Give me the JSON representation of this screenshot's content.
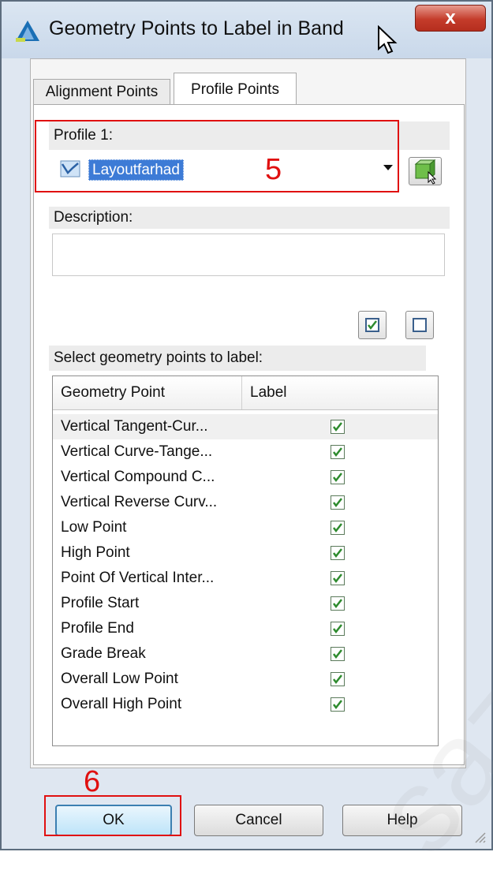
{
  "window": {
    "title": "Geometry Points to Label in Band",
    "close_label": "x"
  },
  "tabs": [
    {
      "label": "Alignment Points",
      "active": false
    },
    {
      "label": "Profile Points",
      "active": true
    }
  ],
  "profile": {
    "label": "Profile 1:",
    "selected_value": "Layoutfarhad"
  },
  "description": {
    "label": "Description:",
    "value": ""
  },
  "select_label": "Select geometry points to label:",
  "grid": {
    "columns": [
      "Geometry Point",
      "Label"
    ],
    "rows": [
      {
        "name": "Vertical Tangent-Cur...",
        "checked": true
      },
      {
        "name": "Vertical Curve-Tange...",
        "checked": true
      },
      {
        "name": "Vertical Compound C...",
        "checked": true
      },
      {
        "name": "Vertical Reverse Curv...",
        "checked": true
      },
      {
        "name": "Low Point",
        "checked": true
      },
      {
        "name": "High Point",
        "checked": true
      },
      {
        "name": "Point Of Vertical Inter...",
        "checked": true
      },
      {
        "name": "Profile Start",
        "checked": true
      },
      {
        "name": "Profile End",
        "checked": true
      },
      {
        "name": "Grade Break",
        "checked": true
      },
      {
        "name": "Overall Low Point",
        "checked": true
      },
      {
        "name": "Overall High Point",
        "checked": true
      }
    ]
  },
  "buttons": {
    "ok": "OK",
    "cancel": "Cancel",
    "help": "Help"
  },
  "annotations": {
    "profile_marker": "5",
    "ok_marker": "6"
  },
  "colors": {
    "annotation_red": "#e01010",
    "selection_blue": "#3d7bd6",
    "checkmark_green": "#2e8b2e"
  }
}
